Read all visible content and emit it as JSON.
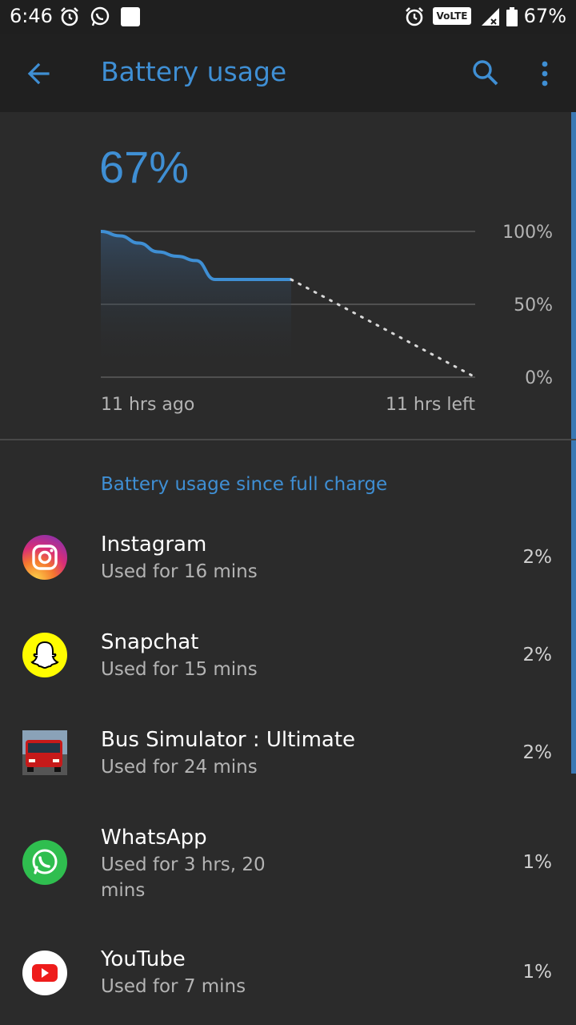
{
  "status_bar": {
    "time": "6:46",
    "volte": "VoLTE",
    "battery": "67%"
  },
  "app_bar": {
    "title": "Battery usage",
    "back_icon": "back-arrow-icon",
    "search_icon": "search-icon",
    "more_icon": "more-vert-icon"
  },
  "summary": {
    "battery_level": "67%"
  },
  "chart_data": {
    "type": "line",
    "x_labels": [
      "11 hrs ago",
      "11 hrs left"
    ],
    "y_ticks": [
      "100%",
      "50%",
      "0%"
    ],
    "ylim": [
      0,
      100
    ],
    "series": [
      {
        "values": [
          100,
          97,
          92,
          86,
          83,
          80,
          67,
          67,
          67,
          67,
          67
        ]
      },
      {
        "projected_end": 0
      }
    ],
    "grid": true
  },
  "section_title": "Battery usage since full charge",
  "apps": [
    {
      "name": "Instagram",
      "usage": "Used for 16 mins",
      "percent": "2%",
      "icon": "instagram-icon"
    },
    {
      "name": "Snapchat",
      "usage": "Used for 15 mins",
      "percent": "2%",
      "icon": "snapchat-icon"
    },
    {
      "name": "Bus Simulator : Ultimate",
      "usage": "Used for 24 mins",
      "percent": "2%",
      "icon": "bus-simulator-icon"
    },
    {
      "name": "WhatsApp",
      "usage": "Used for 3 hrs, 20 mins",
      "percent": "1%",
      "icon": "whatsapp-icon"
    },
    {
      "name": "YouTube",
      "usage": "Used for 7 mins",
      "percent": "1%",
      "icon": "youtube-icon"
    }
  ],
  "colors": {
    "accent": "#3f8fd4",
    "background": "#2b2b2b",
    "app_bar": "#202020"
  }
}
